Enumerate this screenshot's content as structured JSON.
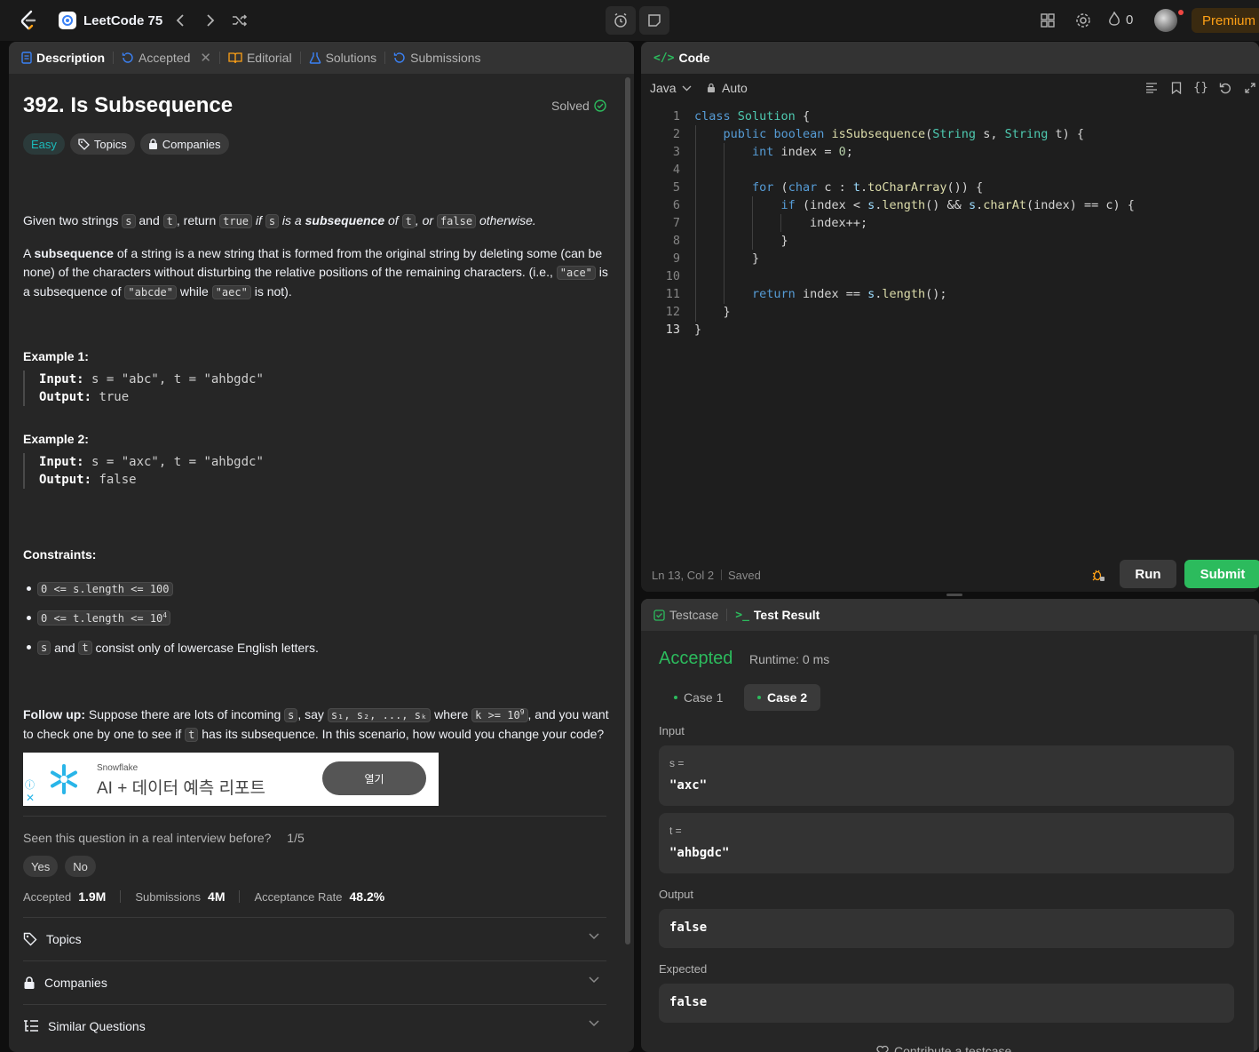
{
  "nav": {
    "problem_list": "LeetCode 75",
    "streak_count": "0",
    "premium": "Premium"
  },
  "left_tabs": [
    {
      "label": "Description"
    },
    {
      "label": "Accepted"
    },
    {
      "label": "Editorial"
    },
    {
      "label": "Solutions"
    },
    {
      "label": "Submissions"
    }
  ],
  "problem": {
    "title": "392. Is Subsequence",
    "status": "Solved",
    "difficulty": "Easy",
    "topics_pill": "Topics",
    "companies_pill": "Companies",
    "p1": {
      "a": "Given two strings ",
      "s": "s",
      "b": " and ",
      "t": "t",
      "c": ", return ",
      "true": "true",
      "d": " if ",
      "s2": "s",
      "e": " is a ",
      "f": "subsequence",
      "g": " of ",
      "t2": "t",
      "h": ", or ",
      "false": "false",
      "i": " otherwise."
    },
    "p2": {
      "a": "A ",
      "b": "subsequence",
      "c": " of a string is a new string that is formed from the original string by deleting some (can be none) of the characters without disturbing the relative positions of the remaining characters. (i.e., ",
      "ace": "\"ace\"",
      "d": " is a subsequence of ",
      "abcde": "\"abcde\"",
      "e": " while ",
      "aec": "\"aec\"",
      "f": " is not)."
    },
    "example1": {
      "heading": "Example 1:",
      "input_label": "Input:",
      "input": " s = \"abc\", t = \"ahbgdc\"",
      "output_label": "Output:",
      "output": " true"
    },
    "example2": {
      "heading": "Example 2:",
      "input_label": "Input:",
      "input": " s = \"axc\", t = \"ahbgdc\"",
      "output_label": "Output:",
      "output": " false"
    },
    "constraints_heading": "Constraints:",
    "constraints": {
      "c1": "0 <= s.length <= 100",
      "c2": "0 <= t.length <= 10",
      "c2_sup": "4",
      "c3_s": "s",
      "c3_and": " and ",
      "c3_t": "t",
      "c3_rest": " consist only of lowercase English letters."
    },
    "followup": {
      "label": "Follow up:",
      "a": " Suppose there are lots of incoming ",
      "s": "s",
      "b": ", say ",
      "seq": "s₁, s₂, ..., sₖ",
      "c": " where ",
      "k": "k >= 10",
      "k_sup": "9",
      "d": ", and you want to check one by one to see if ",
      "t": "t",
      "e": " has its subsequence. In this scenario, how would you change your code?"
    }
  },
  "ad": {
    "brand": "Snowflake",
    "headline": "AI + 데이터 예측 리포트",
    "button": "열기"
  },
  "interview": {
    "question": "Seen this question in a real interview before?",
    "count": "1/5",
    "yes": "Yes",
    "no": "No"
  },
  "stats": {
    "accepted_label": "Accepted",
    "accepted": "1.9M",
    "submissions_label": "Submissions",
    "submissions": "4M",
    "rate_label": "Acceptance Rate",
    "rate": "48.2%"
  },
  "accordions": {
    "topics": "Topics",
    "companies": "Companies",
    "similar": "Similar Questions"
  },
  "code_panel": {
    "title": "Code",
    "language": "Java",
    "mode": "Auto",
    "line_numbers": [
      "1",
      "2",
      "3",
      "4",
      "5",
      "6",
      "7",
      "8",
      "9",
      "10",
      "11",
      "12",
      "13"
    ],
    "status_position": "Ln 13, Col 2",
    "status_saved": "Saved",
    "run": "Run",
    "submit": "Submit"
  },
  "code_tokens": {
    "class": "class",
    "Solution": "Solution",
    "public": "public",
    "boolean": "boolean",
    "isSubsequence": "isSubsequence",
    "String": "String",
    "int": "int",
    "for": "for",
    "char": "char",
    "if": "if",
    "return": "return",
    "zero": "0",
    "l1_rest": " {",
    "l2_a": "(",
    "l2_b": " s, ",
    "l2_c": " t) {",
    "l3_rest": " index = ",
    "l3_end": ";",
    "l5_a": " (",
    "l5_b": " c : ",
    "t": "t",
    "l5_c": ".",
    "toCharArray": "toCharArray",
    "l5_d": "()) {",
    "l6_a": " (index < ",
    "s": "s",
    "l6_b": ".",
    "length": "length",
    "l6_c": "() && ",
    "l6_d": ".",
    "charAt": "charAt",
    "l6_e": "(index) == c) {",
    "l7": "index++;",
    "brace": "}",
    "l11_a": " index == ",
    "l11_b": ".",
    "l11_c": "();"
  },
  "result_panel": {
    "testcase_tab": "Testcase",
    "result_tab": "Test Result",
    "verdict": "Accepted",
    "runtime": "Runtime: 0 ms",
    "case1": "Case 1",
    "case2": "Case 2",
    "input_label": "Input",
    "s_label": "s =",
    "s_value": "\"axc\"",
    "t_label": "t =",
    "t_value": "\"ahbgdc\"",
    "output_label": "Output",
    "output_value": "false",
    "expected_label": "Expected",
    "expected_value": "false",
    "contribute": "Contribute a testcase"
  },
  "colors": {
    "accepted_green": "#2cbb5d",
    "premium_orange": "#ffa116",
    "easy_teal": "#1cbaba"
  }
}
